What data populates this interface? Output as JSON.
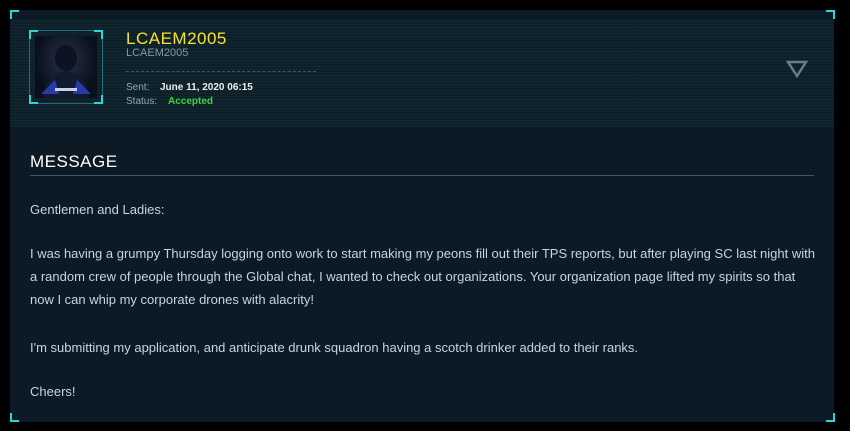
{
  "header": {
    "handle": "LCAEM2005",
    "moniker": "LCAEM2005",
    "sent_label": "Sent:",
    "sent_value": "June 11, 2020 06:15",
    "status_label": "Status:",
    "status_value": "Accepted"
  },
  "colors": {
    "accent": "#2bd6d6",
    "handle": "#f4e332",
    "status_accepted": "#3dd43d",
    "panel_bg": "#0b1a24"
  },
  "toggle_icon": "chevron-down-triangle-icon",
  "message": {
    "title": "MESSAGE",
    "paragraphs": [
      "Gentlemen and Ladies:",
      "I was having a grumpy Thursday logging onto work to start making my peons fill out their TPS reports, but after playing SC last night with a random crew of people through the Global chat, I wanted to check out organizations. Your organization page lifted my spirits so that now I can whip my corporate drones with alacrity!",
      "I'm submitting my application, and anticipate drunk squadron having a scotch drinker added to their ranks.",
      "Cheers!"
    ]
  }
}
